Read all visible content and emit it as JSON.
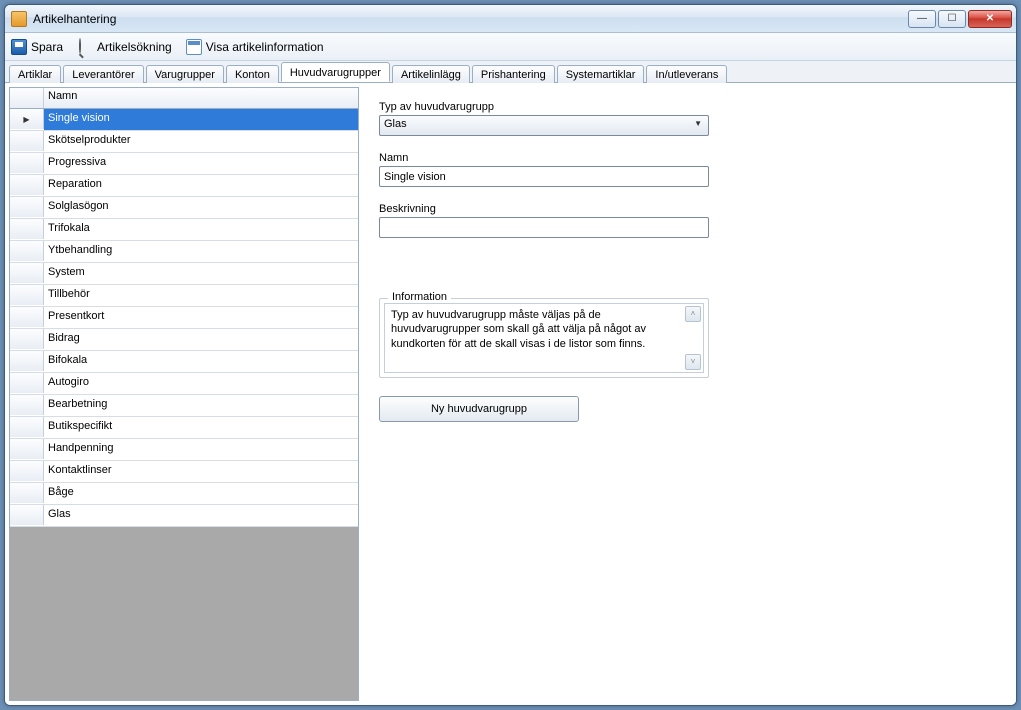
{
  "window": {
    "title": "Artikelhantering"
  },
  "toolbar": {
    "save": "Spara",
    "search": "Artikelsökning",
    "showinfo": "Visa artikelinformation"
  },
  "tabs": [
    {
      "label": "Artiklar"
    },
    {
      "label": "Leverantörer"
    },
    {
      "label": "Varugrupper"
    },
    {
      "label": "Konton"
    },
    {
      "label": "Huvudvarugrupper",
      "active": true
    },
    {
      "label": "Artikelinlägg"
    },
    {
      "label": "Prishantering"
    },
    {
      "label": "Systemartiklar"
    },
    {
      "label": "In/utleverans"
    }
  ],
  "grid": {
    "header": "Namn",
    "rows": [
      "Single vision",
      "Skötselprodukter",
      "Progressiva",
      "Reparation",
      "Solglasögon",
      "Trifokala",
      "Ytbehandling",
      "System",
      "Tillbehör",
      "Presentkort",
      "Bidrag",
      "Bifokala",
      "Autogiro",
      "Bearbetning",
      "Butikspecifikt",
      "Handpenning",
      "Kontaktlinser",
      "Båge",
      "Glas"
    ],
    "selectedIndex": 0
  },
  "form": {
    "type_label": "Typ av huvudvarugrupp",
    "type_value": "Glas",
    "name_label": "Namn",
    "name_value": "Single vision",
    "desc_label": "Beskrivning",
    "desc_value": "",
    "info_legend": "Information",
    "info_text": "Typ av huvudvarugrupp måste väljas på de huvudvarugrupper som skall gå att välja på något av kundkorten för att de skall visas i de listor som finns.",
    "new_button": "Ny huvudvarugrupp"
  }
}
